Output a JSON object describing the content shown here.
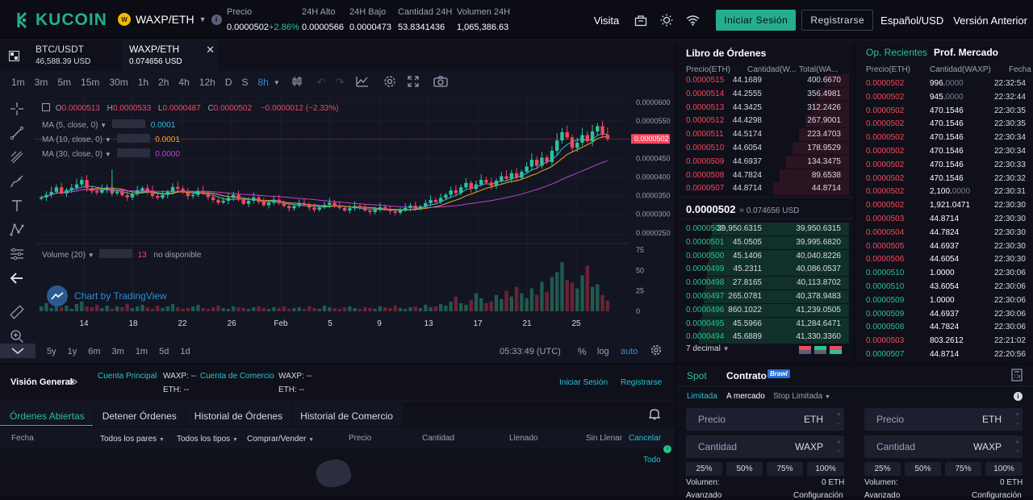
{
  "header": {
    "logo_text": "KUCOIN",
    "pair": "WAXP/ETH",
    "coin_badge": "W",
    "stats": [
      {
        "label": "Precio",
        "value": "0.0000502",
        "change": "+2.86%"
      },
      {
        "label": "24H Alto",
        "value": "0.0000566"
      },
      {
        "label": "24H Bajo",
        "value": "0.0000473"
      },
      {
        "label": "Cantidad 24H",
        "value": "53.8341436"
      },
      {
        "label": "Volumen 24H",
        "value": "1,065,386.63"
      }
    ],
    "visita": "Visita",
    "login": "Iniciar Sesión",
    "register": "Registrarse",
    "language": "Español/USD",
    "old_version": "Versión Anterior"
  },
  "chart_tabs": [
    {
      "pair": "BTC/USDT",
      "price": "46,588.39 USD"
    },
    {
      "pair": "WAXP/ETH",
      "price": "0.074656 USD"
    }
  ],
  "timeframes": [
    "1m",
    "3m",
    "5m",
    "15m",
    "30m",
    "1h",
    "2h",
    "4h",
    "12h",
    "D",
    "S",
    "8h"
  ],
  "active_timeframe": "8h",
  "ohlc": {
    "o": "0.0000513",
    "h": "0.0000533",
    "l": "0.0000487",
    "c": "0.0000502",
    "chg": "−0.0000012 (−2.33%)"
  },
  "ma": [
    {
      "label": "MA (5, close, 0)",
      "value": "0.0001",
      "color": "#2bc2d4"
    },
    {
      "label": "MA (10, close, 0)",
      "value": "0.0001",
      "color": "#f5a623"
    },
    {
      "label": "MA (30, close, 0)",
      "value": "0.0000",
      "color": "#c13fd6"
    }
  ],
  "volume_label": "Volume (20)",
  "volume_val": "13",
  "volume_na": "no disponible",
  "watermark": "Chart by TradingView",
  "chart_data": {
    "type": "candlestick",
    "y_ticks": [
      "0.0000600",
      "0.0000550",
      "0.0000500",
      "0.0000450",
      "0.0000400",
      "0.0000350",
      "0.0000300",
      "0.0000250"
    ],
    "vol_ticks": [
      "75",
      "50",
      "25",
      "0"
    ],
    "x_ticks": [
      "14",
      "18",
      "22",
      "26",
      "Feb",
      "5",
      "9",
      "13",
      "17",
      "21",
      "25"
    ],
    "last_price": "0.0000502",
    "close": [
      3.45e-05,
      3.52e-05,
      3.6e-05,
      3.72e-05,
      3.56e-05,
      3.65e-05,
      3.71e-05,
      3.8e-05,
      3.92e-05,
      3.7e-05,
      3.62e-05,
      3.58e-05,
      3.66e-05,
      3.72e-05,
      3.56e-05,
      3.6e-05,
      3.51e-05,
      3.45e-05,
      3.55e-05,
      3.64e-05,
      3.7e-05,
      3.62e-05,
      3.49e-05,
      3.44e-05,
      3.52e-05,
      3.6e-05,
      3.73e-05,
      3.68e-05,
      3.58e-05,
      3.49e-05,
      3.52e-05,
      3.62e-05,
      3.56e-05,
      3.46e-05,
      3.38e-05,
      3.31e-05,
      3.36e-05,
      3.44e-05,
      3.52e-05,
      3.4e-05,
      3.28e-05,
      3.36e-05,
      3.45e-05,
      3.33e-05,
      3.24e-05,
      3.31e-05,
      3.39e-05,
      3.3e-05,
      3.22e-05,
      3.16e-05,
      3.22e-05,
      3.3e-05,
      3.25e-05,
      3.18e-05,
      3.12e-05,
      3.18e-05,
      3.25e-05,
      3.31e-05,
      3.24e-05,
      3.17e-05,
      3.1e-05,
      3.16e-05,
      3.22e-05,
      3.17e-05,
      3.1e-05,
      3.06e-05,
      3.12e-05,
      3.19e-05,
      3.13e-05,
      3.08e-05,
      3.04e-05,
      3.1e-05,
      3.17e-05,
      3.23e-05,
      3.15e-05,
      3.21e-05,
      3.3e-05,
      3.38e-05,
      3.33e-05,
      3.44e-05,
      3.52e-05,
      3.64e-05,
      3.57e-05,
      3.72e-05,
      3.84e-05,
      3.68e-05,
      3.8e-05,
      3.92e-05,
      3.85e-05,
      3.76e-05,
      3.9e-05,
      4.02e-05,
      3.95e-05,
      4.1e-05,
      3.98e-05,
      4.14e-05,
      4.28e-05,
      4.46e-05,
      4.3e-05,
      4.52e-05,
      4.4e-05,
      4.7e-05,
      4.98e-05,
      5.2e-05,
      5.06e-05,
      4.78e-05,
      4.92e-05,
      5.12e-05,
      4.96e-05,
      5.22e-05,
      5.36e-05,
      5.13e-05,
      5.02e-05
    ],
    "volume": [
      6,
      10,
      4,
      8,
      5,
      7,
      3,
      9,
      12,
      6,
      5,
      8,
      4,
      7,
      3,
      6,
      5,
      9,
      4,
      6,
      8,
      5,
      3,
      7,
      4,
      6,
      9,
      5,
      3,
      4,
      6,
      8,
      4,
      3,
      5,
      7,
      4,
      3,
      6,
      5,
      4,
      3,
      5,
      6,
      4,
      3,
      5,
      4,
      6,
      3,
      4,
      5,
      3,
      6,
      4,
      3,
      7,
      5,
      4,
      3,
      5,
      6,
      4,
      3,
      5,
      4,
      3,
      6,
      5,
      4,
      7,
      4,
      3,
      5,
      6,
      4,
      8,
      5,
      6,
      9,
      7,
      12,
      18,
      10,
      8,
      14,
      22,
      16,
      10,
      12,
      20,
      15,
      25,
      18,
      30,
      22,
      16,
      28,
      20,
      36,
      24,
      42,
      48,
      60,
      38,
      35,
      28,
      44,
      56,
      30,
      33,
      20,
      13
    ],
    "ylim": [
      2.3e-05,
      6.15e-05
    ]
  },
  "chart_footer": {
    "ranges": [
      "5y",
      "1y",
      "6m",
      "3m",
      "1m",
      "5d",
      "1d"
    ],
    "time": "05:33:49 (UTC)",
    "pct": "%",
    "log": "log",
    "auto": "auto"
  },
  "orderbook": {
    "title": "Libro de Órdenes",
    "col_price": "Precio(ETH)",
    "col_qty": "Cantidad(W...",
    "col_total": "Total(WA...",
    "asks": [
      {
        "p": "0.0000515",
        "q": "44.1689",
        "t": "400.6670"
      },
      {
        "p": "0.0000514",
        "q": "44.2555",
        "t": "356.4981"
      },
      {
        "p": "0.0000513",
        "q": "44.3425",
        "t": "312.2426"
      },
      {
        "p": "0.0000512",
        "q": "44.4298",
        "t": "267.9001"
      },
      {
        "p": "0.0000511",
        "q": "44.5174",
        "t": "223.4703"
      },
      {
        "p": "0.0000510",
        "q": "44.6054",
        "t": "178.9529"
      },
      {
        "p": "0.0000509",
        "q": "44.6937",
        "t": "134.3475"
      },
      {
        "p": "0.0000508",
        "q": "44.7824",
        "t": "89.6538"
      },
      {
        "p": "0.0000507",
        "q": "44.8714",
        "t": "44.8714"
      }
    ],
    "mid_price": "0.0000502",
    "mid_usd": "≈ 0.074656 USD",
    "bids": [
      {
        "p": "0.0000502",
        "q": "39,950.6315",
        "t": "39,950.6315"
      },
      {
        "p": "0.0000501",
        "q": "45.0505",
        "t": "39,995.6820"
      },
      {
        "p": "0.0000500",
        "q": "45.1406",
        "t": "40,040.8226"
      },
      {
        "p": "0.0000499",
        "q": "45.2311",
        "t": "40,086.0537"
      },
      {
        "p": "0.0000498",
        "q": "27.8165",
        "t": "40,113.8702"
      },
      {
        "p": "0.0000497",
        "q": "265.0781",
        "t": "40,378.9483"
      },
      {
        "p": "0.0000496",
        "q": "860.1022",
        "t": "41,239.0505"
      },
      {
        "p": "0.0000495",
        "q": "45.5966",
        "t": "41,284.6471"
      },
      {
        "p": "0.0000494",
        "q": "45.6889",
        "t": "41,330.3360"
      }
    ],
    "decimals": "7 decimal"
  },
  "trades": {
    "tab_recent": "Op. Recientes",
    "tab_depth": "Prof. Mercado",
    "col_price": "Precio(ETH)",
    "col_qty": "Cantidad(WAXP)",
    "col_time": "Fecha",
    "rows": [
      {
        "p": "0.0000502",
        "q": "996.",
        "qd": "0000",
        "t": "22:32:54",
        "side": "sell"
      },
      {
        "p": "0.0000502",
        "q": "945.",
        "qd": "0000",
        "t": "22:32:44",
        "side": "sell"
      },
      {
        "p": "0.0000502",
        "q": "470.1546",
        "qd": "",
        "t": "22:30:35",
        "side": "sell"
      },
      {
        "p": "0.0000502",
        "q": "470.1546",
        "qd": "",
        "t": "22:30:35",
        "side": "sell"
      },
      {
        "p": "0.0000502",
        "q": "470.1546",
        "qd": "",
        "t": "22:30:34",
        "side": "sell"
      },
      {
        "p": "0.0000502",
        "q": "470.1546",
        "qd": "",
        "t": "22:30:34",
        "side": "sell"
      },
      {
        "p": "0.0000502",
        "q": "470.1546",
        "qd": "",
        "t": "22:30:33",
        "side": "sell"
      },
      {
        "p": "0.0000502",
        "q": "470.1546",
        "qd": "",
        "t": "22:30:32",
        "side": "sell"
      },
      {
        "p": "0.0000502",
        "q": "2,100.",
        "qd": "0000",
        "t": "22:30:31",
        "side": "sell"
      },
      {
        "p": "0.0000502",
        "q": "1,921.0471",
        "qd": "",
        "t": "22:30:30",
        "side": "sell"
      },
      {
        "p": "0.0000503",
        "q": "44.8714",
        "qd": "",
        "t": "22:30:30",
        "side": "sell"
      },
      {
        "p": "0.0000504",
        "q": "44.7824",
        "qd": "",
        "t": "22:30:30",
        "side": "sell"
      },
      {
        "p": "0.0000505",
        "q": "44.6937",
        "qd": "",
        "t": "22:30:30",
        "side": "sell"
      },
      {
        "p": "0.0000506",
        "q": "44.6054",
        "qd": "",
        "t": "22:30:30",
        "side": "sell"
      },
      {
        "p": "0.0000510",
        "q": "1.0000",
        "qd": "",
        "t": "22:30:06",
        "side": "buy"
      },
      {
        "p": "0.0000510",
        "q": "43.6054",
        "qd": "",
        "t": "22:30:06",
        "side": "buy"
      },
      {
        "p": "0.0000509",
        "q": "1.0000",
        "qd": "",
        "t": "22:30:06",
        "side": "buy"
      },
      {
        "p": "0.0000509",
        "q": "44.6937",
        "qd": "",
        "t": "22:30:06",
        "side": "buy"
      },
      {
        "p": "0.0000508",
        "q": "44.7824",
        "qd": "",
        "t": "22:30:06",
        "side": "buy"
      },
      {
        "p": "0.0000503",
        "q": "803.2612",
        "qd": "",
        "t": "22:21:02",
        "side": "sell"
      },
      {
        "p": "0.0000507",
        "q": "44.8714",
        "qd": "",
        "t": "22:20:56",
        "side": "buy"
      }
    ]
  },
  "overview": {
    "title": "Visión General",
    "main_account": "Cuenta Principal",
    "trade_account": "Cuenta de Comercio",
    "waxp": "WAXP: --",
    "eth": "ETH: --",
    "login": "Iniciar Sesión",
    "register": "Registrarse"
  },
  "orders": {
    "tabs": [
      "Órdenes Abiertas",
      "Detener Órdenes",
      "Historial de Órdenes",
      "Historial de Comercio"
    ],
    "cols": [
      "Fecha",
      "Todos los pares",
      "Todos los tipos",
      "Comprar/Vender",
      "Precio",
      "Cantidad",
      "Llenado",
      "Sin Llenar"
    ],
    "cancel": "Cancelar",
    "all": "Todo"
  },
  "trade": {
    "tab_spot": "Spot",
    "tab_contract": "Contrato",
    "bravo": "Brawl",
    "types": [
      "Limitada",
      "A mercado",
      "Stop Limitada"
    ],
    "price_label": "Precio",
    "price_unit": "ETH",
    "qty_label": "Cantidad",
    "qty_unit": "WAXP",
    "pcts": [
      "25%",
      "50%",
      "75%",
      "100%"
    ],
    "volume_label": "Volumen:",
    "volume_val": "0 ETH",
    "advanced": "Avanzado",
    "config": "Configuración"
  }
}
